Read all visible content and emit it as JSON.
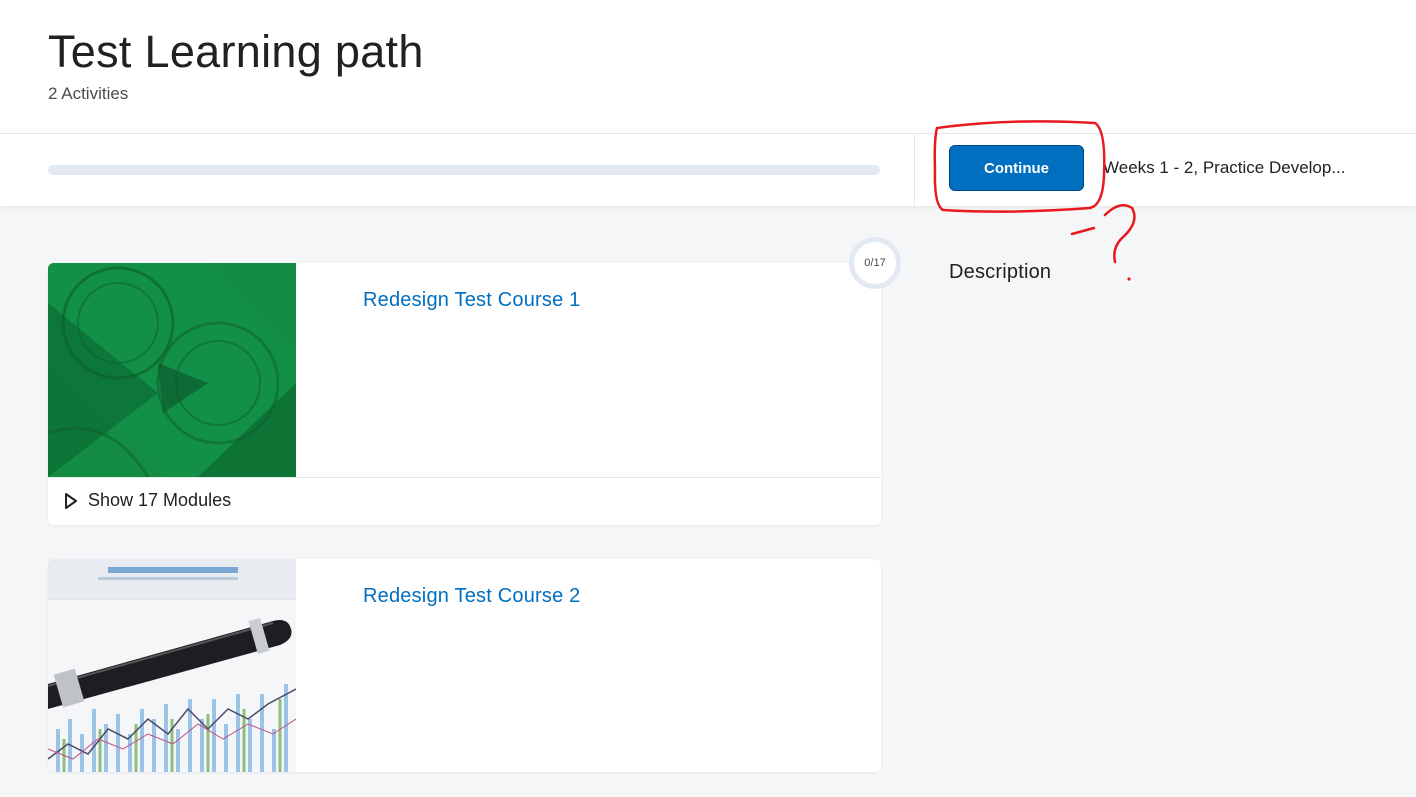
{
  "header": {
    "title": "Test Learning path",
    "subtitle": "2 Activities"
  },
  "progress": {
    "fraction": 0
  },
  "toolbar": {
    "continue_label": "Continue",
    "next_activity": "Weeks 1 - 2, Practice Develop..."
  },
  "courses": [
    {
      "title": "Redesign Test Course 1",
      "progress_badge": "0/17",
      "modules_toggle_label": "Show 17 Modules",
      "image": "green-certificate-image"
    },
    {
      "title": "Redesign Test Course 2",
      "image": "pen-on-chart-image"
    }
  ],
  "sidebar": {
    "description_heading": "Description"
  },
  "colors": {
    "accent": "#006fbf",
    "annotation": "#e8191f",
    "background": "#f5f6f8"
  }
}
